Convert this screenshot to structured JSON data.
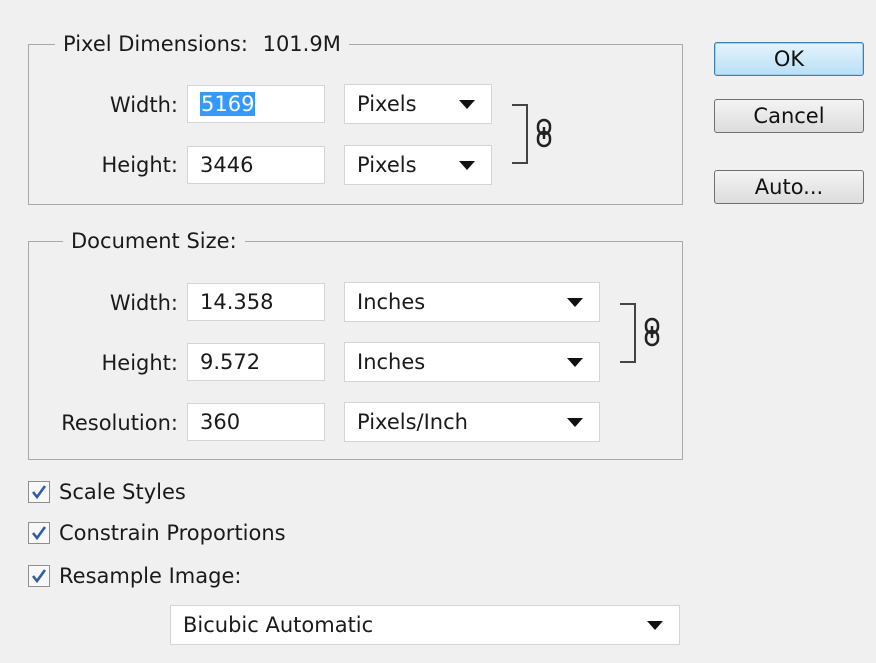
{
  "pixel_dimensions": {
    "title": "Pixel Dimensions:",
    "size": "101.9M",
    "width_label": "Width:",
    "width_value": "5169",
    "width_unit": "Pixels",
    "height_label": "Height:",
    "height_value": "3446",
    "height_unit": "Pixels",
    "constrained": true
  },
  "document_size": {
    "title": "Document Size:",
    "width_label": "Width:",
    "width_value": "14.358",
    "width_unit": "Inches",
    "height_label": "Height:",
    "height_value": "9.572",
    "height_unit": "Inches",
    "resolution_label": "Resolution:",
    "resolution_value": "360",
    "resolution_unit": "Pixels/Inch",
    "constrained": true
  },
  "options": {
    "scale_styles": {
      "label": "Scale Styles",
      "checked": true
    },
    "constrain_proportions": {
      "label": "Constrain Proportions",
      "checked": true
    },
    "resample_image": {
      "label": "Resample Image:",
      "checked": true
    },
    "resample_method": "Bicubic Automatic"
  },
  "buttons": {
    "ok": "OK",
    "cancel": "Cancel",
    "auto": "Auto..."
  },
  "colors": {
    "selection": "#3399ff",
    "check": "#2a5fa8",
    "default_button": "#b9dff6"
  }
}
